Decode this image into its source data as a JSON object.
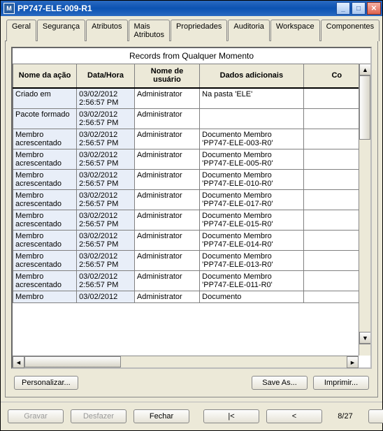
{
  "window": {
    "title": "PP747-ELE-009-R1"
  },
  "tabs": [
    {
      "label": "Geral"
    },
    {
      "label": "Segurança"
    },
    {
      "label": "Atributos"
    },
    {
      "label": "Mais Atributos"
    },
    {
      "label": "Propriedades"
    },
    {
      "label": "Auditoria",
      "active": true
    },
    {
      "label": "Workspace"
    },
    {
      "label": "Componentes"
    }
  ],
  "table": {
    "caption": "Records from Qualquer Momento",
    "headers": [
      "Nome da ação",
      "Data/Hora",
      "Nome de usuário",
      "Dados adicionais",
      "Co"
    ],
    "rows": [
      {
        "c0": "Criado em",
        "c1": "03/02/2012 2:56:57 PM",
        "c2": "Administrator",
        "c3": "Na pasta 'ELE'",
        "c4": ""
      },
      {
        "c0": "Pacote formado",
        "c1": "03/02/2012 2:56:57 PM",
        "c2": "Administrator",
        "c3": "",
        "c4": ""
      },
      {
        "c0": "Membro acrescentado",
        "c1": "03/02/2012 2:56:57 PM",
        "c2": "Administrator",
        "c3": "Documento Membro 'PP747-ELE-003-R0'",
        "c4": ""
      },
      {
        "c0": "Membro acrescentado",
        "c1": "03/02/2012 2:56:57 PM",
        "c2": "Administrator",
        "c3": "Documento Membro 'PP747-ELE-005-R0'",
        "c4": ""
      },
      {
        "c0": "Membro acrescentado",
        "c1": "03/02/2012 2:56:57 PM",
        "c2": "Administrator",
        "c3": "Documento Membro 'PP747-ELE-010-R0'",
        "c4": ""
      },
      {
        "c0": "Membro acrescentado",
        "c1": "03/02/2012 2:56:57 PM",
        "c2": "Administrator",
        "c3": "Documento Membro 'PP747-ELE-017-R0'",
        "c4": ""
      },
      {
        "c0": "Membro acrescentado",
        "c1": "03/02/2012 2:56:57 PM",
        "c2": "Administrator",
        "c3": "Documento Membro 'PP747-ELE-015-R0'",
        "c4": ""
      },
      {
        "c0": "Membro acrescentado",
        "c1": "03/02/2012 2:56:57 PM",
        "c2": "Administrator",
        "c3": "Documento Membro 'PP747-ELE-014-R0'",
        "c4": ""
      },
      {
        "c0": "Membro acrescentado",
        "c1": "03/02/2012 2:56:57 PM",
        "c2": "Administrator",
        "c3": "Documento Membro 'PP747-ELE-013-R0'",
        "c4": ""
      },
      {
        "c0": "Membro acrescentado",
        "c1": "03/02/2012 2:56:57 PM",
        "c2": "Administrator",
        "c3": "Documento Membro 'PP747-ELE-011-R0'",
        "c4": ""
      },
      {
        "c0": "Membro",
        "c1": "03/02/2012",
        "c2": "Administrator",
        "c3": "Documento",
        "c4": ""
      }
    ]
  },
  "panel_buttons": {
    "personalize": "Personalizar...",
    "save_as": "Save As...",
    "print": "Imprimir..."
  },
  "footer": {
    "save": "Gravar",
    "undo": "Desfazer",
    "close": "Fechar",
    "first": "|<",
    "prev": "<",
    "page": "8/27",
    "next": ">",
    "last": ">|"
  }
}
